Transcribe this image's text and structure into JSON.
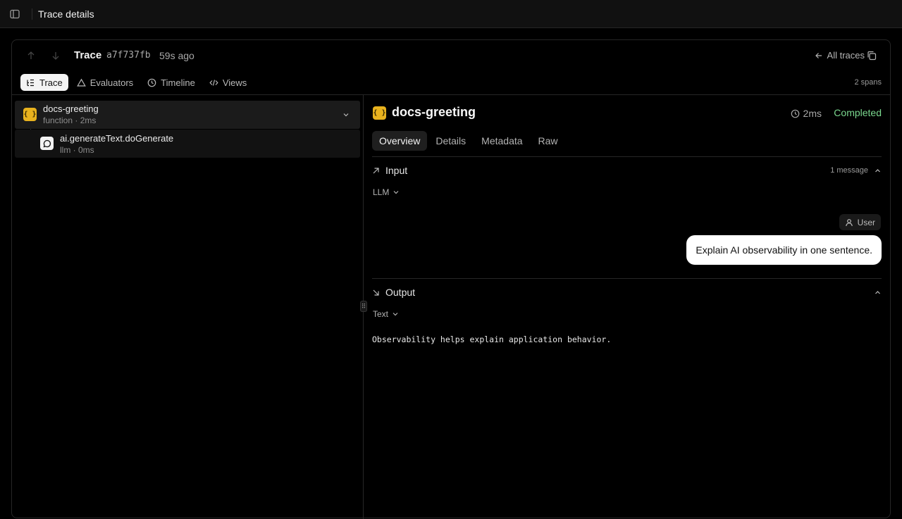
{
  "window": {
    "title": "Trace details"
  },
  "trace": {
    "label": "Trace",
    "id": "a7f737fb",
    "ago": "59s ago",
    "all_traces_label": "All traces",
    "spans_count": "2 spans"
  },
  "view_tabs": [
    {
      "label": "Trace",
      "icon": "list-tree-icon",
      "active": true
    },
    {
      "label": "Evaluators",
      "icon": "triangle-icon",
      "active": false
    },
    {
      "label": "Timeline",
      "icon": "clock-icon",
      "active": false
    },
    {
      "label": "Views",
      "icon": "code-icon",
      "active": false
    }
  ],
  "spans": [
    {
      "name": "docs-greeting",
      "meta": "function · 2ms",
      "icon": "braces-icon",
      "icon_text": "{ }"
    },
    {
      "name": "ai.generateText.doGenerate",
      "meta": "llm · 0ms",
      "icon": "message-icon"
    }
  ],
  "detail": {
    "icon_text": "{ }",
    "title": "docs-greeting",
    "duration": "2ms",
    "status": "Completed",
    "tabs": [
      "Overview",
      "Details",
      "Metadata",
      "Raw"
    ],
    "active_tab": "Overview",
    "input": {
      "label": "Input",
      "count": "1 message",
      "format": "LLM",
      "role": "User",
      "message": "Explain AI observability in one sentence."
    },
    "output": {
      "label": "Output",
      "format": "Text",
      "text": "Observability helps explain application behavior."
    }
  },
  "colors": {
    "function_icon": "#e8b21e",
    "status": "#7bd88f",
    "background": "#000000"
  }
}
